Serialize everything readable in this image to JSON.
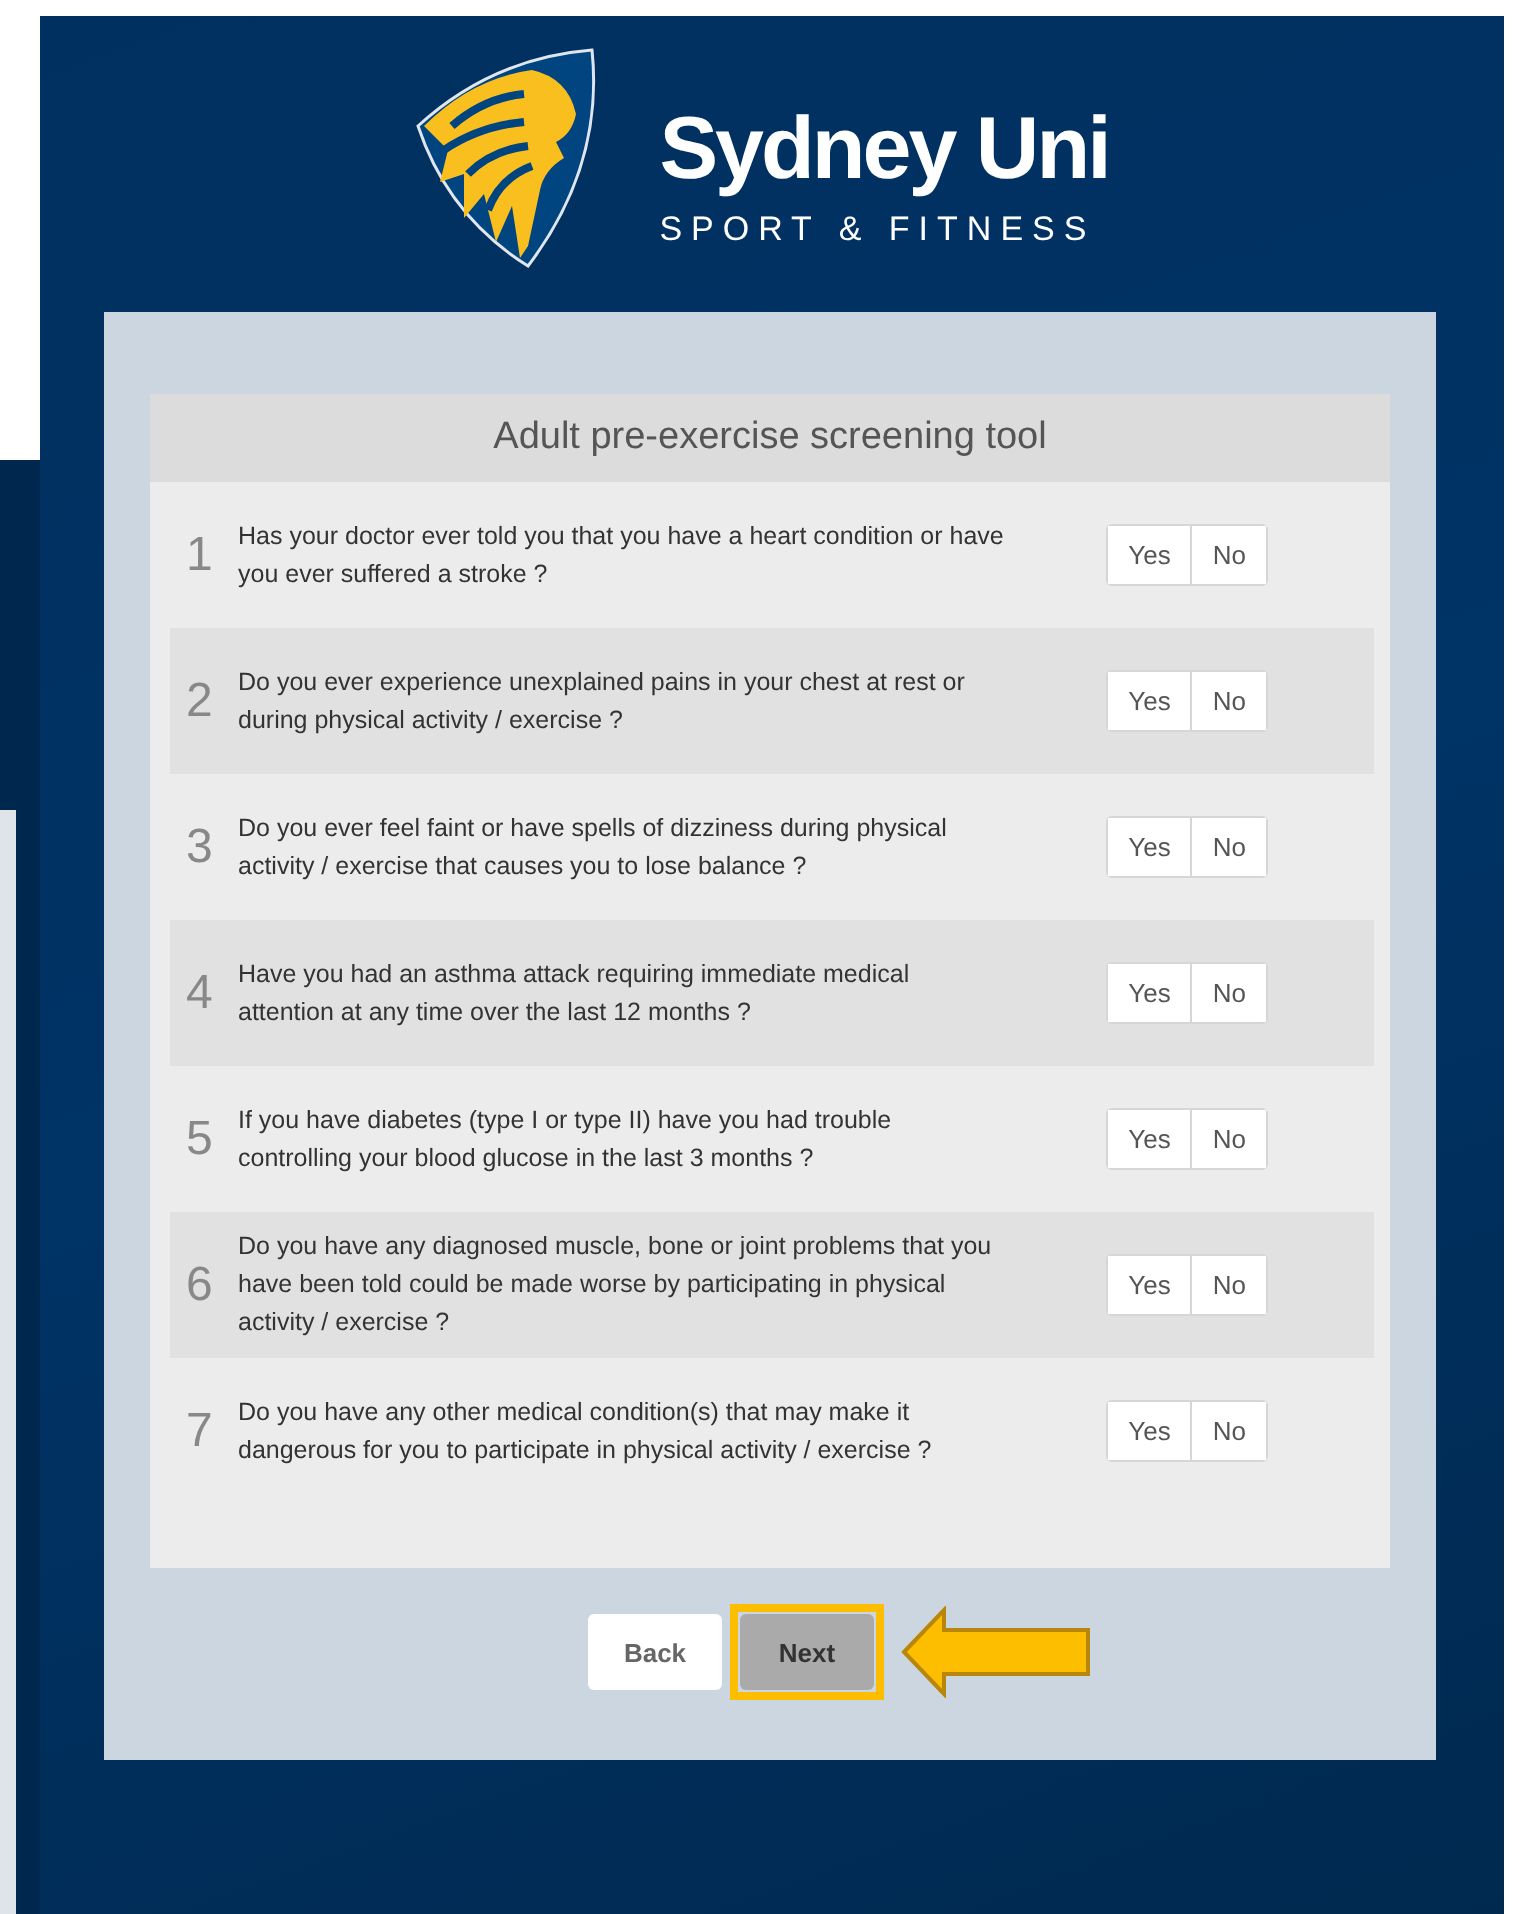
{
  "brand": {
    "name": "Sydney Uni",
    "tagline": "SPORT & FITNESS"
  },
  "form": {
    "title": "Adult pre-exercise screening tool",
    "questions": [
      {
        "number": "1",
        "text": "Has your doctor ever told you that you have a heart condition or have you ever suffered a stroke ?",
        "options": [
          {
            "label": "Yes",
            "selected": false
          },
          {
            "label": "No",
            "selected": false
          }
        ]
      },
      {
        "number": "2",
        "text": "Do you ever experience unexplained pains in your chest at rest or during physical activity / exercise ?",
        "options": [
          {
            "label": "Yes",
            "selected": false
          },
          {
            "label": "No",
            "selected": false
          }
        ]
      },
      {
        "number": "3",
        "text": "Do you ever feel faint or have spells of dizziness during physical activity / exercise that causes you to lose balance ?",
        "options": [
          {
            "label": "Yes",
            "selected": false
          },
          {
            "label": "No",
            "selected": false
          }
        ]
      },
      {
        "number": "4",
        "text": "Have you had an asthma attack requiring immediate medical attention at any time over the last 12 months ?",
        "options": [
          {
            "label": "Yes",
            "selected": false
          },
          {
            "label": "No",
            "selected": false
          }
        ]
      },
      {
        "number": "5",
        "text": "If you have diabetes (type I or type II) have you had trouble controlling your blood glucose in the last 3 months ?",
        "options": [
          {
            "label": "Yes",
            "selected": false
          },
          {
            "label": "No",
            "selected": false
          }
        ]
      },
      {
        "number": "6",
        "text": "Do you have any diagnosed muscle, bone or joint problems that you have been told could be made worse by participating in physical activity / exercise ?",
        "options": [
          {
            "label": "Yes",
            "selected": false
          },
          {
            "label": "No",
            "selected": false
          }
        ]
      },
      {
        "number": "7",
        "text": "Do you have any other medical condition(s) that may make it dangerous for you to participate in physical activity / exercise ?",
        "options": [
          {
            "label": "Yes",
            "selected": false
          },
          {
            "label": "No",
            "selected": false
          }
        ]
      }
    ]
  },
  "buttons": [
    {
      "label": "Back",
      "kind": "secondary",
      "highlighted": false
    },
    {
      "label": "Next",
      "kind": "primary",
      "highlighted": true
    }
  ]
}
